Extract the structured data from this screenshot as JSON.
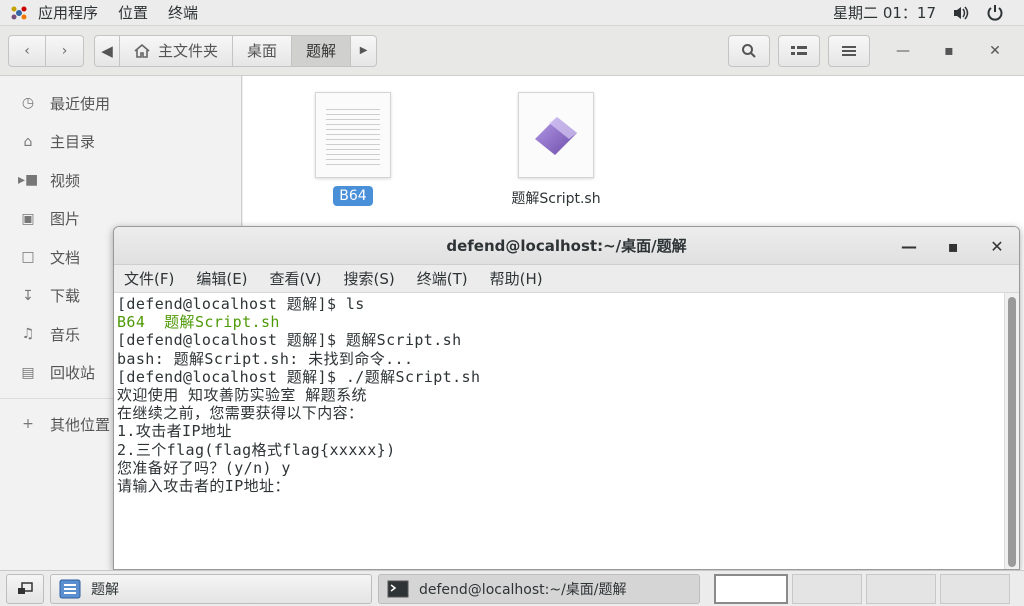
{
  "topbar": {
    "apps": "应用程序",
    "places": "位置",
    "terminal": "终端",
    "clock": "星期二 01：17"
  },
  "fm": {
    "path": [
      "主文件夹",
      "桌面",
      "题解"
    ],
    "sidebar": [
      {
        "label": "最近使用",
        "icon": "clock-icon"
      },
      {
        "label": "主目录",
        "icon": "home-icon"
      },
      {
        "label": "视频",
        "icon": "video-icon"
      },
      {
        "label": "图片",
        "icon": "camera-icon"
      },
      {
        "label": "文档",
        "icon": "document-icon"
      },
      {
        "label": "下载",
        "icon": "download-icon"
      },
      {
        "label": "音乐",
        "icon": "music-icon"
      },
      {
        "label": "回收站",
        "icon": "trash-icon"
      },
      {
        "label": "其他位置",
        "icon": "plus-icon"
      }
    ],
    "files": [
      {
        "name": "B64",
        "selected": true
      },
      {
        "name": "题解Script.sh",
        "selected": false
      }
    ]
  },
  "terminal": {
    "title": "defend@localhost:~/桌面/题解",
    "menu": [
      "文件(F)",
      "编辑(E)",
      "查看(V)",
      "搜索(S)",
      "终端(T)",
      "帮助(H)"
    ],
    "lines": [
      {
        "text": "[defend@localhost 题解]$ ls",
        "color": "normal"
      },
      {
        "text": "B64  题解Script.sh",
        "color": "green"
      },
      {
        "text": "[defend@localhost 题解]$ 题解Script.sh",
        "color": "normal"
      },
      {
        "text": "bash: 题解Script.sh: 未找到命令...",
        "color": "normal"
      },
      {
        "text": "[defend@localhost 题解]$ ./题解Script.sh",
        "color": "normal"
      },
      {
        "text": "欢迎使用 知攻善防实验室 解题系统",
        "color": "normal"
      },
      {
        "text": "在继续之前，您需要获得以下内容：",
        "color": "normal"
      },
      {
        "text": "1.攻击者IP地址",
        "color": "normal"
      },
      {
        "text": "2.三个flag(flag格式flag{xxxxx})",
        "color": "normal"
      },
      {
        "text": "您准备好了吗？(y/n) y",
        "color": "normal"
      },
      {
        "text": "请输入攻击者的IP地址：",
        "color": "normal"
      }
    ]
  },
  "taskbar": {
    "task1": "题解",
    "task2": "defend@localhost:~/桌面/题解"
  },
  "colors": {
    "accent": "#4a90d9",
    "terminal_green": "#4e9a06"
  }
}
